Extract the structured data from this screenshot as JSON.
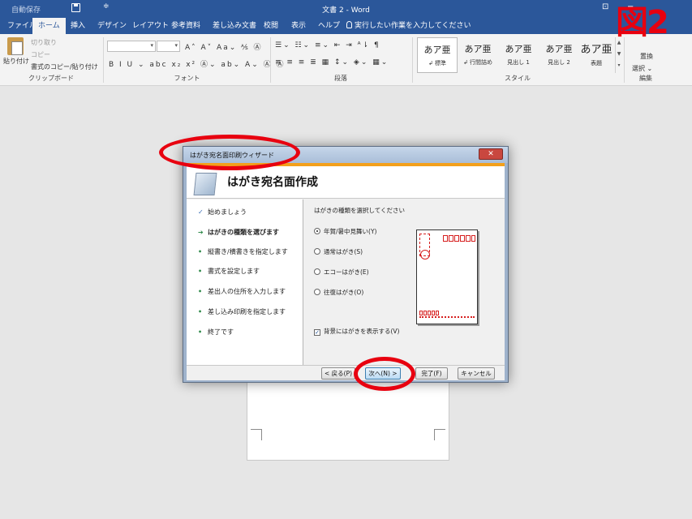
{
  "titlebar": {
    "autosave": "自動保存",
    "qat_more": "≑",
    "title": "文書 2 - Word",
    "box_glyph": "⊡",
    "minimize_glyph": "−"
  },
  "tabs": [
    "ファイル",
    "ホーム",
    "挿入",
    "デザイン",
    "レイアウト",
    "参考資料",
    "差し込み文書",
    "校閲",
    "表示",
    "ヘルプ"
  ],
  "tell_me": "実行したい作業を入力してください",
  "ribbon": {
    "clipboard": {
      "paste": "貼り付け",
      "cut": "切り取り",
      "copy": "コピー",
      "format_painter": "書式のコピー/貼り付け",
      "label": "クリップボード"
    },
    "font": {
      "label": "フォント",
      "row1_icons": "A˄ A˅ Aa⌄ ⅍ Ⓐ",
      "row2_icons": "B I U ⌄ abc x₂ x² Ⓐ⌄ ab⌄ A⌄ Ⓐ Ⓐ"
    },
    "paragraph": {
      "label": "段落",
      "row1_icons": "☰⌄ ☷⌄ ≡⌄ ⇤ ⇥ ᴬ⇂ ¶",
      "row2_icons": "≡ ≡ ≡ ≣ ▦ ↕⌄ ◈⌄ ▦⌄"
    },
    "styles": {
      "label": "スタイル",
      "items": [
        {
          "sample": "あア亜",
          "name": "↲ 標準"
        },
        {
          "sample": "あア亜",
          "name": "↲ 行間詰め"
        },
        {
          "sample": "あア亜",
          "name": "見出し 1"
        },
        {
          "sample": "あア亜",
          "name": "見出し 2"
        },
        {
          "sample": "あア亜",
          "name": "表題"
        }
      ]
    },
    "editing": {
      "label": "編集",
      "replace": "置換",
      "select": "選択 ⌄"
    }
  },
  "figure_label": "図2",
  "dialog": {
    "title": "はがき宛名面印刷ウィザード",
    "close": "✕",
    "heading": "はがき宛名面作成",
    "steps": [
      {
        "mark": "✓",
        "label": "始めましょう",
        "state": "done"
      },
      {
        "mark": "➔",
        "label": "はがきの種類を選びます",
        "state": "current"
      },
      {
        "mark": "•",
        "label": "縦書き/横書きを指定します",
        "state": "todo"
      },
      {
        "mark": "•",
        "label": "書式を設定します",
        "state": "todo"
      },
      {
        "mark": "•",
        "label": "差出人の住所を入力します",
        "state": "todo"
      },
      {
        "mark": "•",
        "label": "差し込み印刷を指定します",
        "state": "todo"
      },
      {
        "mark": "•",
        "label": "終了です",
        "state": "todo"
      }
    ],
    "prompt": "はがきの種類を選択してください",
    "options": [
      {
        "label": "年賀/暑中見舞い(Y)",
        "selected": true
      },
      {
        "label": "通常はがき(S)",
        "selected": false
      },
      {
        "label": "エコーはがき(E)",
        "selected": false
      },
      {
        "label": "往復はがき(O)",
        "selected": false
      }
    ],
    "background_checkbox": {
      "label": "背景にはがきを表示する(V)",
      "checked": true,
      "mark": "✓"
    },
    "buttons": {
      "back": "< 戻る(P)",
      "next": "次へ(N) >",
      "finish": "完了(F)",
      "cancel": "キャンセル"
    }
  },
  "colors": {
    "word_blue": "#2b579a",
    "annotation_red": "#e8000f",
    "wizard_accent": "#f3a01c"
  }
}
